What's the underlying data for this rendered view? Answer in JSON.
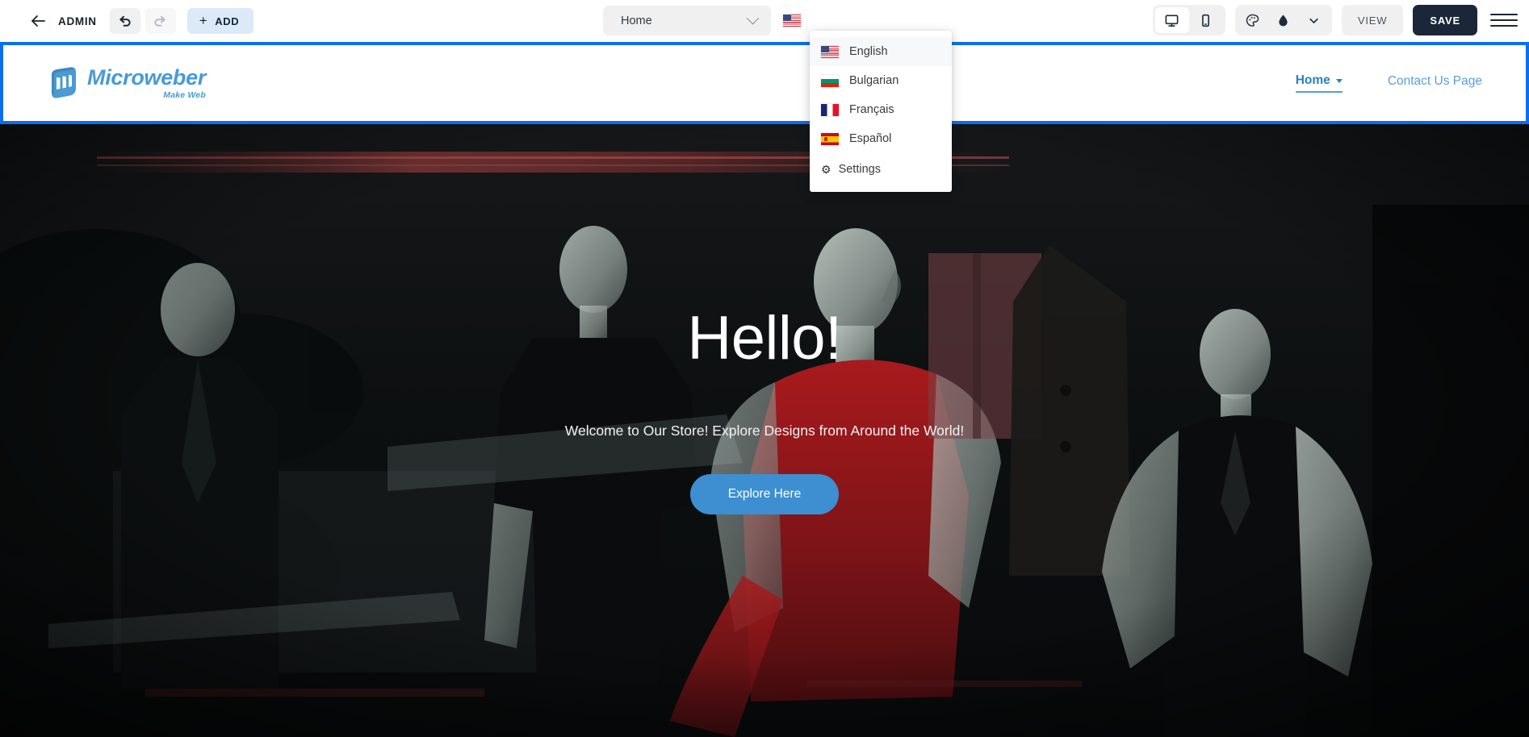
{
  "admin_bar": {
    "back_icon": "arrow-left-icon",
    "admin_label": "ADMIN",
    "undo_icon": "undo-icon",
    "redo_icon": "redo-icon",
    "add_label": "ADD",
    "add_icon": "plus-icon",
    "page_selector": {
      "value": "Home",
      "chevron_icon": "chevron-down-icon"
    },
    "language_button_icon": "flag-us-icon",
    "device_desktop_icon": "desktop-icon",
    "device_mobile_icon": "mobile-icon",
    "palette_icon": "palette-icon",
    "droplet_icon": "droplet-icon",
    "style_chevron_icon": "chevron-down-icon",
    "view_label": "VIEW",
    "save_label": "SAVE",
    "menu_icon": "hamburger-menu-icon"
  },
  "language_menu": {
    "items": [
      {
        "label": "English",
        "flag": "flag-us-icon",
        "current": true
      },
      {
        "label": "Bulgarian",
        "flag": "flag-bg-icon",
        "current": false
      },
      {
        "label": "Français",
        "flag": "flag-fr-icon",
        "current": false
      },
      {
        "label": "Español",
        "flag": "flag-es-icon",
        "current": false
      }
    ],
    "settings_label": "Settings",
    "settings_icon": "gear-icon"
  },
  "site": {
    "logo": {
      "icon": "microweber-logo-icon",
      "name": "Microweber",
      "tagline": "Make Web",
      "color": "#4a9ad4"
    },
    "nav": [
      {
        "label": "Home",
        "active": true,
        "has_caret": true
      },
      {
        "label": "Contact Us Page",
        "active": false,
        "has_caret": false
      }
    ],
    "hero": {
      "title": "Hello!",
      "subtitle": "Welcome to Our Store! Explore Designs from Around the World!",
      "button_label": "Explore Here",
      "button_color": "#3d8fd1",
      "background": "dark shop window with mannequins"
    }
  },
  "colors": {
    "selection_outline": "#0b6ef0",
    "save_button": "#1b2738",
    "add_button": "#dce9f7",
    "brand_blue": "#4a9ad4"
  }
}
